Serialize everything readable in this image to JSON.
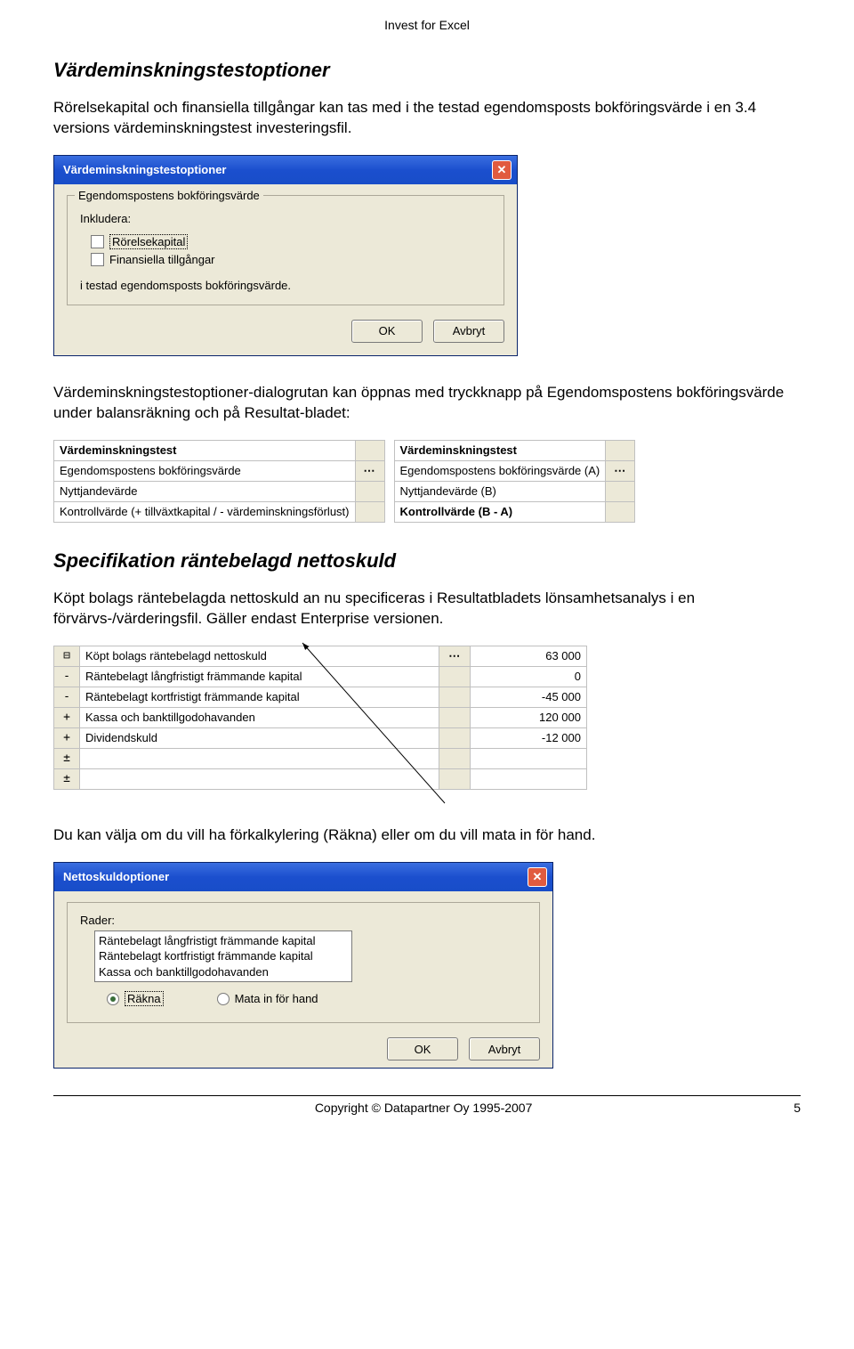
{
  "header": {
    "title": "Invest for Excel"
  },
  "section1": {
    "heading": "Värdeminskningstestoptioner",
    "para": "Rörelsekapital och finansiella tillgångar kan tas med i the testad egendomsposts bokföringsvärde i en 3.4 versions värdeminskningstest investeringsfil."
  },
  "dialog1": {
    "title": "Värdeminskningstestoptioner",
    "group_legend": "Egendomspostens bokföringsvärde",
    "include_label": "Inkludera:",
    "check1": "Rörelsekapital",
    "check2": "Finansiella tillgångar",
    "footer_text": "i testad egendomsposts bokföringsvärde.",
    "ok": "OK",
    "cancel": "Avbryt"
  },
  "para2": "Värdeminskningstestoptioner-dialogrutan kan öppnas med tryckknapp på Egendomspostens bokföringsvärde under balansräkning och på Resultat-bladet:",
  "tableA": {
    "r1": "Värdeminskningstest",
    "r2": "Egendomspostens bokföringsvärde",
    "r3": "Nyttjandevärde",
    "r4": "Kontrollvärde (+ tillväxtkapital / - värdeminskningsförlust)"
  },
  "tableB": {
    "r1": "Värdeminskningstest",
    "r2": "Egendomspostens bokföringsvärde (A)",
    "r3": "Nyttjandevärde (B)",
    "r4": "Kontrollvärde (B - A)"
  },
  "section2": {
    "heading": "Specifikation räntebelagd nettoskuld",
    "para": "Köpt bolags räntebelagda nettoskuld an nu specificeras i Resultatbladets lönsamhetsanalys i en förvärvs-/värderingsfil. Gäller endast Enterprise versionen."
  },
  "netto": {
    "r1_label": "Köpt bolags räntebelagd nettoskuld",
    "r1_val": "63 000",
    "r2_label": "Räntebelagt långfristigt främmande kapital",
    "r2_val": "0",
    "r3_label": "Räntebelagt kortfristigt främmande kapital",
    "r3_val": "-45 000",
    "r4_label": "Kassa och banktillgodohavanden",
    "r4_val": "120 000",
    "r5_label": "Dividendskuld",
    "r5_val": "-12 000",
    "s2": "-",
    "s3": "-",
    "s4": "+",
    "s5": "+",
    "s6": "±",
    "s7": "±"
  },
  "para3": "Du kan välja om du vill ha förkalkylering (Räkna) eller om du vill mata in för hand.",
  "dialog2": {
    "title": "Nettoskuldoptioner",
    "rows_label": "Rader:",
    "list1": "Räntebelagt långfristigt främmande kapital",
    "list2": "Räntebelagt kortfristigt främmande kapital",
    "list3": "Kassa och banktillgodohavanden",
    "radio1": "Räkna",
    "radio2": "Mata in för hand",
    "ok": "OK",
    "cancel": "Avbryt"
  },
  "footer": {
    "copyright": "Copyright © Datapartner Oy 1995-2007",
    "page": "5"
  }
}
